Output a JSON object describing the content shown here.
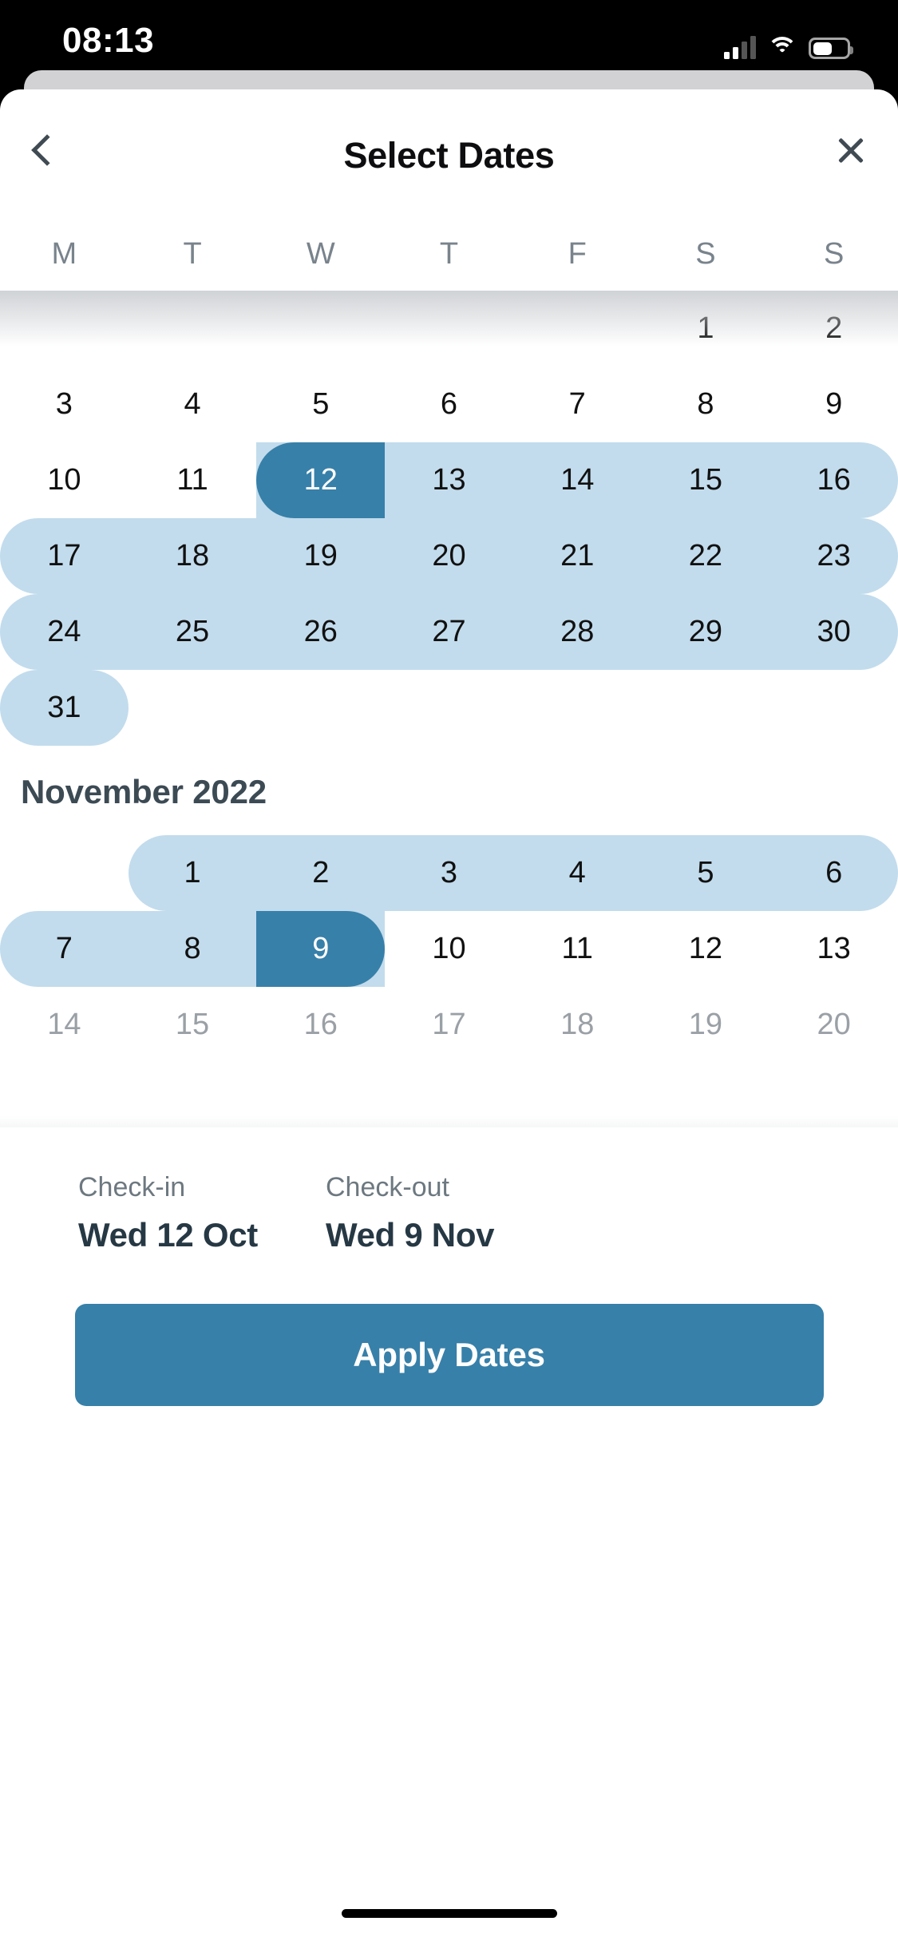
{
  "status_bar": {
    "time": "08:13",
    "icons": [
      "cellular-signal-icon",
      "wifi-icon",
      "battery-icon"
    ]
  },
  "header": {
    "title": "Select Dates",
    "back_icon": "chevron-left-icon",
    "close_icon": "close-icon"
  },
  "weekdays": [
    "M",
    "T",
    "W",
    "T",
    "F",
    "S",
    "S"
  ],
  "colors": {
    "selected": "#3780a9",
    "range": "#c2dced",
    "text_dark": "#263844",
    "text_muted": "#6d7880"
  },
  "months": [
    {
      "title": "",
      "weeks": [
        [
          {
            "day": "",
            "state": "empty"
          },
          {
            "day": "",
            "state": "empty"
          },
          {
            "day": "",
            "state": "empty"
          },
          {
            "day": "",
            "state": "empty"
          },
          {
            "day": "",
            "state": "empty"
          },
          {
            "day": "1",
            "state": "normal"
          },
          {
            "day": "2",
            "state": "normal"
          }
        ],
        [
          {
            "day": "3",
            "state": "normal"
          },
          {
            "day": "4",
            "state": "normal"
          },
          {
            "day": "5",
            "state": "normal"
          },
          {
            "day": "6",
            "state": "normal"
          },
          {
            "day": "7",
            "state": "normal"
          },
          {
            "day": "8",
            "state": "normal"
          },
          {
            "day": "9",
            "state": "normal"
          }
        ],
        [
          {
            "day": "10",
            "state": "normal"
          },
          {
            "day": "11",
            "state": "normal"
          },
          {
            "day": "12",
            "state": "selected-start"
          },
          {
            "day": "13",
            "state": "in-range"
          },
          {
            "day": "14",
            "state": "in-range"
          },
          {
            "day": "15",
            "state": "in-range"
          },
          {
            "day": "16",
            "state": "in-range-end"
          }
        ],
        [
          {
            "day": "17",
            "state": "in-range-start"
          },
          {
            "day": "18",
            "state": "in-range"
          },
          {
            "day": "19",
            "state": "in-range"
          },
          {
            "day": "20",
            "state": "in-range"
          },
          {
            "day": "21",
            "state": "in-range"
          },
          {
            "day": "22",
            "state": "in-range"
          },
          {
            "day": "23",
            "state": "in-range-end"
          }
        ],
        [
          {
            "day": "24",
            "state": "in-range-start"
          },
          {
            "day": "25",
            "state": "in-range"
          },
          {
            "day": "26",
            "state": "in-range"
          },
          {
            "day": "27",
            "state": "in-range"
          },
          {
            "day": "28",
            "state": "in-range"
          },
          {
            "day": "29",
            "state": "in-range"
          },
          {
            "day": "30",
            "state": "in-range-end"
          }
        ],
        [
          {
            "day": "31",
            "state": "in-range-solo"
          },
          {
            "day": "",
            "state": "empty"
          },
          {
            "day": "",
            "state": "empty"
          },
          {
            "day": "",
            "state": "empty"
          },
          {
            "day": "",
            "state": "empty"
          },
          {
            "day": "",
            "state": "empty"
          },
          {
            "day": "",
            "state": "empty"
          }
        ]
      ]
    },
    {
      "title": "November 2022",
      "weeks": [
        [
          {
            "day": "",
            "state": "empty"
          },
          {
            "day": "1",
            "state": "in-range-start"
          },
          {
            "day": "2",
            "state": "in-range"
          },
          {
            "day": "3",
            "state": "in-range"
          },
          {
            "day": "4",
            "state": "in-range"
          },
          {
            "day": "5",
            "state": "in-range"
          },
          {
            "day": "6",
            "state": "in-range-end"
          }
        ],
        [
          {
            "day": "7",
            "state": "in-range-start"
          },
          {
            "day": "8",
            "state": "in-range"
          },
          {
            "day": "9",
            "state": "selected-end"
          },
          {
            "day": "10",
            "state": "normal"
          },
          {
            "day": "11",
            "state": "normal"
          },
          {
            "day": "12",
            "state": "normal"
          },
          {
            "day": "13",
            "state": "normal"
          }
        ],
        [
          {
            "day": "14",
            "state": "dim"
          },
          {
            "day": "15",
            "state": "dim"
          },
          {
            "day": "16",
            "state": "dim"
          },
          {
            "day": "17",
            "state": "dim"
          },
          {
            "day": "18",
            "state": "dim"
          },
          {
            "day": "19",
            "state": "dim"
          },
          {
            "day": "20",
            "state": "dim"
          }
        ]
      ]
    }
  ],
  "footer": {
    "checkin_label": "Check-in",
    "checkin_value": "Wed 12 Oct",
    "checkout_label": "Check-out",
    "checkout_value": "Wed 9 Nov",
    "apply_label": "Apply Dates"
  }
}
